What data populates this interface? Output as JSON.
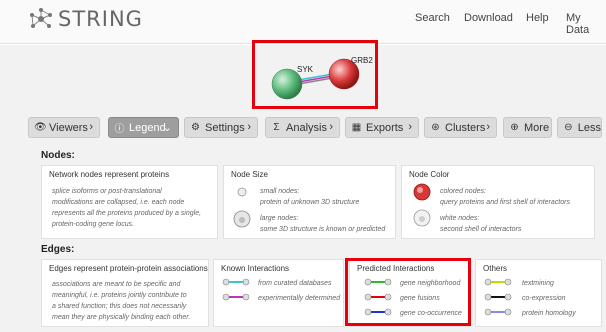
{
  "header": {
    "logo_text": "STRING",
    "nav": [
      "Search",
      "Download",
      "Help",
      "My Data"
    ]
  },
  "network": {
    "node1": "SYK",
    "node2": "GRB2",
    "colors": {
      "node1": "#5ab87a",
      "node2": "#d93838",
      "highlight": "#e5000b"
    }
  },
  "toolbar": {
    "viewers": "Viewers",
    "legend": "Legend",
    "settings": "Settings",
    "analysis": "Analysis",
    "exports": "Exports",
    "clusters": "Clusters",
    "more": "More",
    "less": "Less"
  },
  "nodes": {
    "title": "Nodes:",
    "network_nodes": {
      "title": "Network nodes represent proteins",
      "text": [
        "splice isoforms or post-translational",
        "modifications are collapsed, i.e. each node",
        "represents all the proteins produced by a single,",
        "protein-coding gene locus."
      ]
    },
    "node_size": {
      "title": "Node Size",
      "small": [
        "small nodes:",
        "protein of unknown 3D structure"
      ],
      "large": [
        "large nodes:",
        "some 3D structure is known or predicted"
      ]
    },
    "node_color": {
      "title": "Node Color",
      "colored": [
        "colored nodes:",
        "query proteins and first shell of interactors"
      ],
      "white": [
        "white nodes:",
        "second shell of interactors"
      ]
    }
  },
  "edges": {
    "title": "Edges:",
    "assoc": {
      "title": "Edges represent protein-protein associations",
      "text": [
        "associations are meant to be specific and",
        "meaningful, i.e. proteins jointly contribute to",
        "a shared function; this does not necessarily",
        "mean they are physically binding each other."
      ]
    },
    "known": {
      "title": "Known Interactions",
      "items": [
        {
          "label": "from curated databases",
          "color": "#38c6cc"
        },
        {
          "label": "experimentally determined",
          "color": "#c032c0"
        }
      ]
    },
    "predicted": {
      "title": "Predicted Interactions",
      "items": [
        {
          "label": "gene neighborhood",
          "color": "#2eb82e"
        },
        {
          "label": "gene fusions",
          "color": "#e5000b"
        },
        {
          "label": "gene co-occurrence",
          "color": "#2233cc"
        }
      ]
    },
    "others": {
      "title": "Others",
      "items": [
        {
          "label": "textmining",
          "color": "#c8d900"
        },
        {
          "label": "co-expression",
          "color": "#111111"
        },
        {
          "label": "protein homology",
          "color": "#8888ee"
        }
      ]
    }
  }
}
